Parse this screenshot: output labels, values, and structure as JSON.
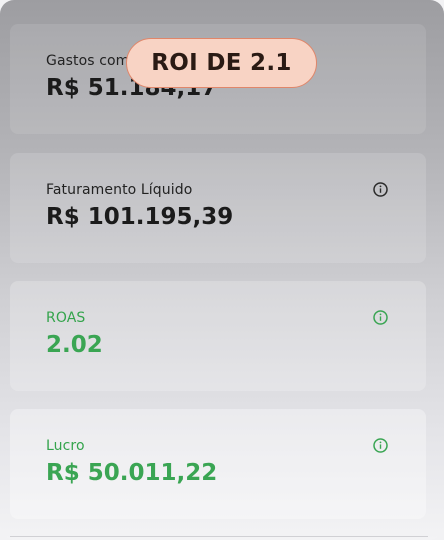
{
  "badge": {
    "text": "ROI DE 2.1"
  },
  "cards": [
    {
      "label": "Gastos com",
      "value": "R$ 51.184,17",
      "info_icon": false
    },
    {
      "label": "Faturamento Líquido",
      "value": "R$ 101.195,39",
      "info_icon": true,
      "icon_color": "#2b2b2b"
    },
    {
      "label": "ROAS",
      "value": "2.02",
      "info_icon": true,
      "icon_color": "#3aa553"
    },
    {
      "label": "Lucro",
      "value": "R$ 50.011,22",
      "info_icon": true,
      "icon_color": "#3aa553"
    }
  ],
  "colors": {
    "accent_green": "#3aa553",
    "badge_bg": "#f8d3c4",
    "badge_border": "#e0866a"
  },
  "icons": {
    "info": "info-circle-icon"
  }
}
